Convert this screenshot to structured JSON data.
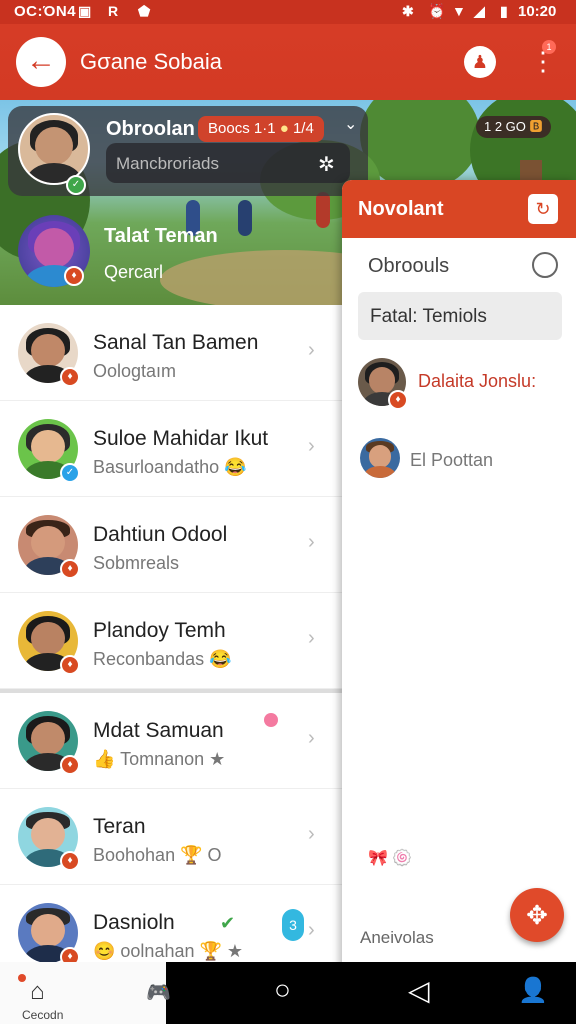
{
  "status_bar": {
    "left": "OC:ΌΝ4",
    "time": "10:20",
    "icons": [
      "photo-icon",
      "r-icon",
      "shield-icon",
      "bluetooth-icon",
      "alarm-icon",
      "wifi-icon",
      "signal-icon",
      "battery-icon"
    ]
  },
  "app_bar": {
    "title": "Gσane Sobaia",
    "back_icon": "←",
    "robot_icon": "♟",
    "menu_icon": "⋮",
    "menu_badge": "1"
  },
  "scene": {
    "counter": "1 2 GO",
    "counter_icon": "🅱"
  },
  "featured": {
    "name": "Obroolan",
    "pill": "Boocs 1·1",
    "pill_extra": "1/4",
    "input_text": "Mancbroriads",
    "star_icon": "✲",
    "chevron": "⌄"
  },
  "featured2": {
    "name": "Talat Teman",
    "sub": "Qercarl"
  },
  "contacts": [
    {
      "name": "Sanal Tan Bamen",
      "sub": "Oologtaım",
      "badge": "red"
    },
    {
      "name": "Suloe Mahidar Ikut",
      "sub": "Basurloandatho 😂",
      "badge": "blue"
    },
    {
      "name": "Dahtiun Odool",
      "sub": "Sobmreals",
      "badge": "red"
    },
    {
      "name": "Plandoy Temh",
      "sub": "Reconbandas 😂",
      "badge": "red"
    },
    {
      "name": "Mdat Samuan",
      "sub": "👍 Tomnanon ★",
      "badge": "red"
    },
    {
      "name": "Teran",
      "sub": "Boohohan 🏆 O",
      "badge": "red"
    },
    {
      "name": "Dasnioln",
      "sub": "😊 oolnahan 🏆 ★",
      "badge": "red"
    }
  ],
  "panel": {
    "title": "Novolant",
    "header_button_icon": "↻",
    "tab": "Obroouls",
    "search_value": "Fatal: Temiols",
    "results": [
      "Dalaita Jonslu:",
      "El Poottan"
    ],
    "emoji_row": "🎀 🍥",
    "footer": "Aneivolas"
  },
  "fab_icon": "✥",
  "bottom_nav": {
    "home_label": "Cecodn",
    "home_icon": "⌂",
    "second_icon": "🎮",
    "circle": "○",
    "back": "◁",
    "profile": "👤"
  },
  "colors": {
    "primary": "#d33a24",
    "accent": "#e04a2a",
    "badge_green": "#3fa64a",
    "badge_blue": "#2aa2e8"
  }
}
